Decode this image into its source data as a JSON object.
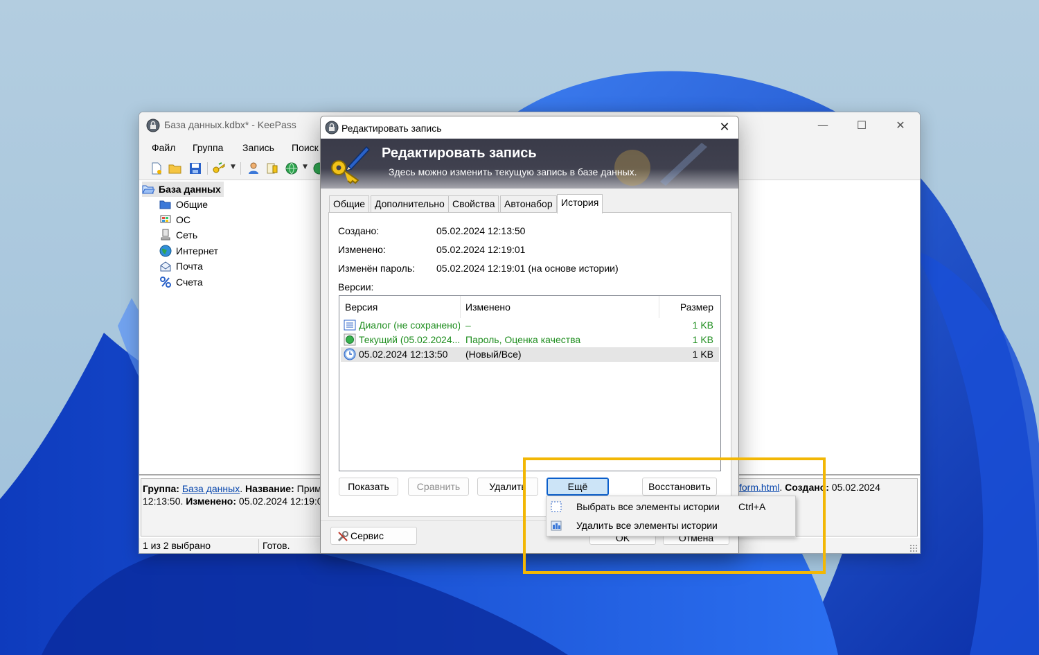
{
  "main_window": {
    "title": "База данных.kdbx* - KeePass",
    "menu": [
      "Файл",
      "Группа",
      "Запись",
      "Поиск"
    ],
    "tree": {
      "root": "База данных",
      "groups": [
        "Общие",
        "ОС",
        "Сеть",
        "Интернет",
        "Почта",
        "Счета"
      ]
    },
    "info_panel": {
      "group_label": "Группа:",
      "group_value": "База данных",
      "title_label": "Название:",
      "title_value_partial": "Прим",
      "created_time_tail": "12:13:50.",
      "modified_label": "Изменено:",
      "modified_value_partial": "05.02.2024 12:19:0",
      "link_tail": "form.html",
      "created_label": "Создано:",
      "created_value": "05.02.2024"
    },
    "status": {
      "selected": "1 из 2 выбрано",
      "state": "Готов."
    }
  },
  "dialog": {
    "title": "Редактировать запись",
    "banner_title": "Редактировать запись",
    "banner_subtitle": "Здесь можно изменить текущую запись в базе данных.",
    "tabs": [
      "Общие",
      "Дополнительно",
      "Свойства",
      "Автонабор",
      "История"
    ],
    "active_tab": "История",
    "fields": {
      "created_label": "Создано:",
      "created_value": "05.02.2024 12:13:50",
      "modified_label": "Изменено:",
      "modified_value": "05.02.2024 12:19:01",
      "pwd_changed_label": "Изменён пароль:",
      "pwd_changed_value": "05.02.2024 12:19:01 (на основе истории)",
      "versions_label": "Версии:"
    },
    "versions_table": {
      "columns": [
        "Версия",
        "Изменено",
        "Размер"
      ],
      "rows": [
        {
          "version": "Диалог (не сохранено)",
          "changed": "–",
          "size": "1 KB",
          "color": "#1f8e1f",
          "icon": "list-icon"
        },
        {
          "version": "Текущий (05.02.2024...",
          "changed": "Пароль, Оценка качества",
          "size": "1 KB",
          "color": "#1f8e1f",
          "icon": "green-dot-icon"
        },
        {
          "version": "05.02.2024 12:13:50",
          "changed": "(Новый/Все)",
          "size": "1 KB",
          "color": "#000000",
          "icon": "clock-icon",
          "selected": true
        }
      ]
    },
    "buttons": {
      "show": "Показать",
      "compare": "Сравнить",
      "delete": "Удалить",
      "more": "Ещё",
      "restore": "Восстановить",
      "tools": "Сервис",
      "ok": "OK",
      "cancel": "Отмена"
    }
  },
  "context_menu": {
    "items": [
      {
        "label": "Выбрать все элементы истории",
        "shortcut": "Ctrl+A",
        "icon": "select-all-icon"
      },
      {
        "label": "Удалить все элементы истории",
        "shortcut": "",
        "icon": "delete-all-icon"
      }
    ]
  },
  "colors": {
    "highlight": "#f2b705",
    "banner": "#3a3b49",
    "link": "#0645ad",
    "green_text": "#1f8e1f",
    "selection": "#cce4f7"
  }
}
